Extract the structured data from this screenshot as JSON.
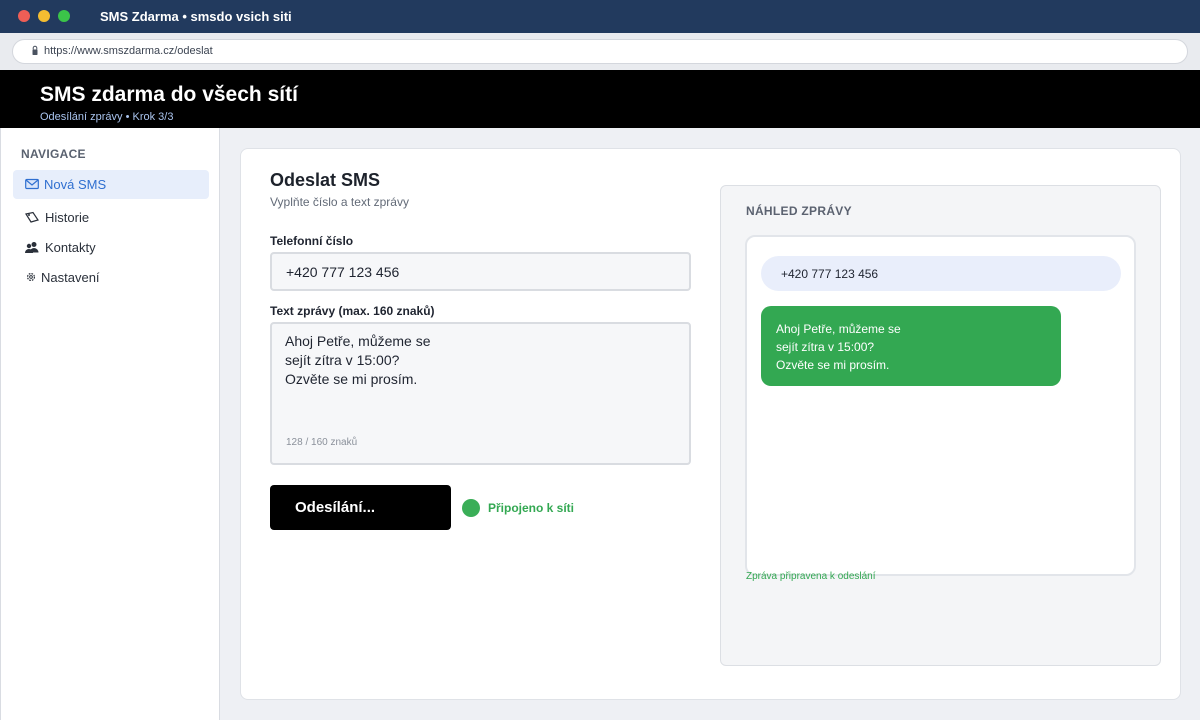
{
  "window": {
    "title": "SMS Zdarma • smsdo vsich siti"
  },
  "browser": {
    "url": "https://www.smszdarma.cz/odeslat"
  },
  "header": {
    "title": "SMS zdarma do všech sítí",
    "subtitle": "Odesílání zprávy • Krok 3/3"
  },
  "sidebar": {
    "heading": "NAVIGACE",
    "items": [
      {
        "label": "Nová SMS",
        "icon": "envelope-icon",
        "active": true
      },
      {
        "label": "Historie",
        "icon": "tag-icon",
        "active": false
      },
      {
        "label": "Kontakty",
        "icon": "contacts-icon",
        "active": false
      },
      {
        "label": "Nastavení",
        "icon": "gear-icon",
        "active": false
      }
    ]
  },
  "form": {
    "title": "Odeslat SMS",
    "subtitle": "Vyplňte číslo a text zprávy",
    "phone_label": "Telefonní číslo",
    "phone_value": "+420 777 123 456",
    "message_label": "Text zprávy (max. 160 znaků)",
    "message_value": "Ahoj Petře, můžeme se\nsejít zítra v 15:00?\nOzvěte se mi prosím.",
    "char_count": "128 / 160 znaků",
    "send_label": "Odesílání...",
    "status_text": "Připojeno k síti"
  },
  "preview": {
    "title": "NÁHLED ZPRÁVY",
    "recipient": "+420 777 123 456",
    "message": "Ahoj Petře, můžeme se\nsejít zítra v 15:00?\nOzvěte se mi prosím.",
    "ready_text": "Zpráva připravena k odeslání"
  },
  "colors": {
    "titlebar": "#223a5e",
    "header": "#000000",
    "accent": "#2f6fd0",
    "success": "#33a852"
  }
}
